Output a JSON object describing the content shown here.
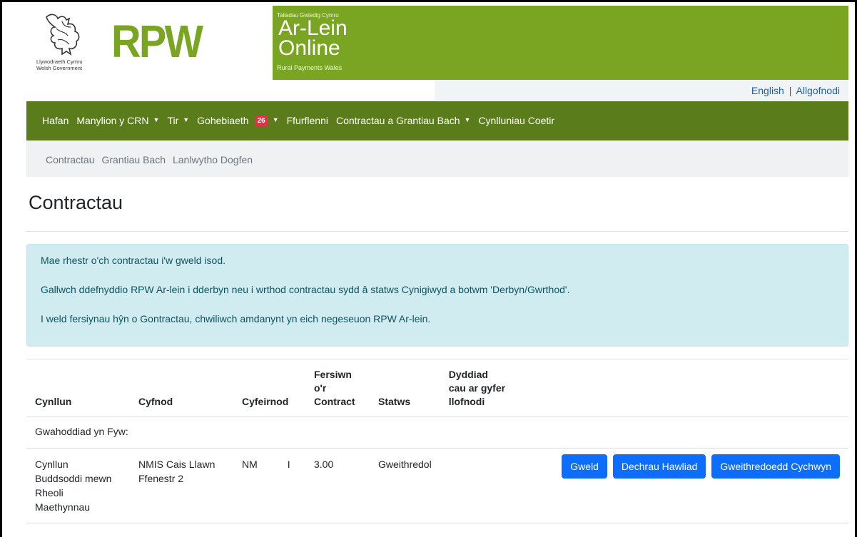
{
  "header": {
    "gov_name_cy": "Llywodraeth Cymru",
    "gov_name_en": "Welsh Government",
    "rpw": "RPW",
    "tagline_top": "Taliadau Gwledig Cymru",
    "ar_lein": "Ar-Lein",
    "online": "Online",
    "tagline_bottom": "Rural Payments Wales",
    "brand_color": "#7aa523"
  },
  "topbar": {
    "english": "English",
    "separator": "|",
    "logout": "Allgofnodi"
  },
  "mainnav": {
    "items": [
      {
        "label": "Hafan"
      },
      {
        "label": "Manylion y CRN"
      },
      {
        "label": "Tir"
      },
      {
        "label": "Gohebiaeth",
        "badge": "26"
      },
      {
        "label": "Ffurflenni"
      },
      {
        "label": "Contractau a Grantiau Bach"
      },
      {
        "label": "Cynlluniau Coetir"
      }
    ],
    "bg_color": "#5b7c1a"
  },
  "subnav": {
    "items": [
      "Contractau",
      "Grantiau Bach",
      "Lanlwytho Dogfen"
    ]
  },
  "page": {
    "title": "Contractau"
  },
  "info": {
    "line1": "Mae rhestr o'ch contractau i'w gweld isod.",
    "line2": "Gallwch ddefnyddio RPW Ar-lein i dderbyn neu i wrthod contractau sydd â statws Cynigiwyd a botwm 'Derbyn/Gwrthod'.",
    "line3": "I weld fersiynau hŷn o Gontractau, chwiliwch amdanynt yn eich negeseuon RPW Ar-lein."
  },
  "table": {
    "headers": {
      "scheme": "Cynllun",
      "period": "Cyfnod",
      "reference": "Cyfeirnod",
      "version_1": "Fersiwn",
      "version_2": "o'r",
      "version_3": "Contract",
      "status": "Statws",
      "closing_1": "Dyddiad",
      "closing_2": "cau ar gyfer",
      "closing_3": "llofnodi"
    },
    "group_label": "Gwahoddiad yn Fyw:",
    "rows": [
      {
        "scheme_1": "Cynllun",
        "scheme_2": "Buddsoddi mewn",
        "scheme_3": "Rheoli",
        "scheme_4": "Maethynnau",
        "period_1": "NMIS Cais Llawn",
        "period_2": "Ffenestr 2",
        "reference": "NM",
        "reference_tail": "I",
        "version": "3.00",
        "status": "Gweithredol",
        "closing": "",
        "btn_view": "Gweld",
        "btn_claim": "Dechrau Hawliad",
        "btn_ops": "Gweithredoedd Cychwyn"
      }
    ]
  }
}
